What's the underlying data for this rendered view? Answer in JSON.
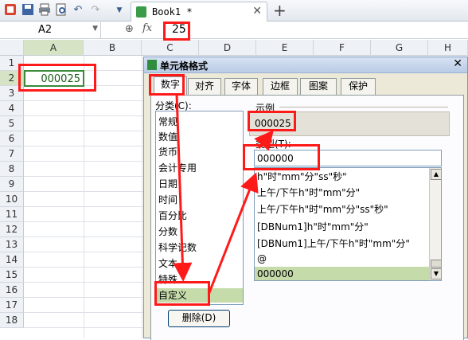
{
  "toolbar": {
    "icons": [
      "app-logo-icon",
      "save-icon",
      "print-icon",
      "print-preview-icon",
      "undo-icon",
      "redo-icon",
      "dropdown-arrow-icon"
    ],
    "tab_label": "Book1 *",
    "new_tab": "+"
  },
  "formula_bar": {
    "cell_ref": "A2",
    "fx": "fx",
    "value": "25"
  },
  "grid": {
    "columns": [
      "A",
      "B",
      "C",
      "D",
      "E",
      "F",
      "G",
      "H"
    ],
    "rows": [
      "1",
      "2",
      "3",
      "4",
      "5",
      "6",
      "7",
      "8",
      "9",
      "10",
      "11",
      "12",
      "13",
      "14",
      "15",
      "16",
      "17",
      "18"
    ],
    "cell_a2": "000025"
  },
  "dialog": {
    "title": "单元格格式",
    "tabs": [
      "数字",
      "对齐",
      "字体",
      "边框",
      "图案",
      "保护"
    ],
    "category_label": "分类(C):",
    "categories": [
      "常规",
      "数值",
      "货币",
      "会计专用",
      "日期",
      "时间",
      "百分比",
      "分数",
      "科学记数",
      "文本",
      "特殊",
      "自定义"
    ],
    "selected_category": "自定义",
    "sample_label": "示例",
    "sample_value": "000025",
    "type_label": "类型(T):",
    "type_value": "000000",
    "formats": [
      "h\"时\"mm\"分\"ss\"秒\"",
      "上午/下午h\"时\"mm\"分\"",
      "上午/下午h\"时\"mm\"分\"ss\"秒\"",
      "[DBNum1]h\"时\"mm\"分\"",
      "[DBNum1]上午/下午h\"时\"mm\"分\"",
      "@",
      "000000"
    ],
    "selected_format": "000000",
    "delete_button": "删除(D)"
  },
  "colors": {
    "highlight": "#ff1a1a",
    "selection": "#c5dcaa",
    "cell_text": "#1a5d1a"
  }
}
